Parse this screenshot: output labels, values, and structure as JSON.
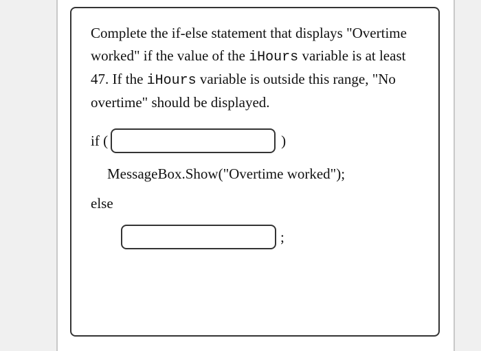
{
  "question": {
    "part1": "Complete the if-else statement that displays \"Overtime worked\" if the value of the ",
    "var1": "iHours",
    "part2": " variable is at least 47. If the ",
    "var2": "iHours",
    "part3": " variable is outside this range, \"No overtime\" should be displayed."
  },
  "code": {
    "if_open": "if (",
    "if_close": ")",
    "msg_line": "MessageBox.Show(\"Overtime worked\");",
    "else_kw": "else",
    "semicolon": ";"
  }
}
